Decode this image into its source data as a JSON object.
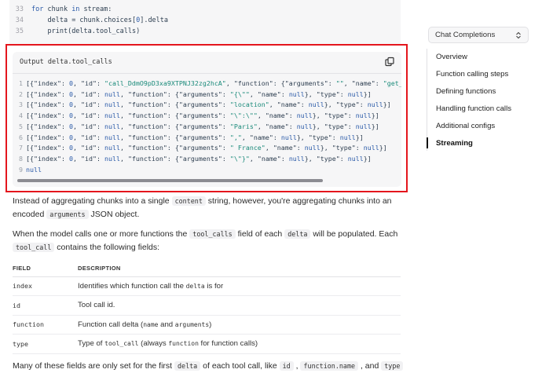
{
  "top_code": {
    "lines": [
      {
        "num": "33",
        "indent": 0,
        "parts": [
          [
            "kw",
            "for"
          ],
          [
            "k",
            " chunk "
          ],
          [
            "kw",
            "in"
          ],
          [
            "k",
            " stream:"
          ]
        ]
      },
      {
        "num": "34",
        "indent": 1,
        "parts": [
          [
            "k",
            "delta = chunk.choices["
          ],
          [
            "n",
            "0"
          ],
          [
            "k",
            "].delta"
          ]
        ]
      },
      {
        "num": "35",
        "indent": 1,
        "parts": [
          [
            "k",
            "print(delta.tool_calls)"
          ]
        ]
      }
    ]
  },
  "output": {
    "title": "Output delta.tool_calls",
    "lines": [
      {
        "num": "1",
        "text": "[{\"index\": 0, \"id\": \"call_DdmO9pD3xa9XTPNJ32zg2hcA\", \"function\": {\"arguments\": \"\", \"name\": \"get_weather\""
      },
      {
        "num": "2",
        "text": "[{\"index\": 0, \"id\": null, \"function\": {\"arguments\": \"{\\\"\", \"name\": null}, \"type\": null}]"
      },
      {
        "num": "3",
        "text": "[{\"index\": 0, \"id\": null, \"function\": {\"arguments\": \"location\", \"name\": null}, \"type\": null}]"
      },
      {
        "num": "4",
        "text": "[{\"index\": 0, \"id\": null, \"function\": {\"arguments\": \"\\\":\\\"\", \"name\": null}, \"type\": null}]"
      },
      {
        "num": "5",
        "text": "[{\"index\": 0, \"id\": null, \"function\": {\"arguments\": \"Paris\", \"name\": null}, \"type\": null}]"
      },
      {
        "num": "6",
        "text": "[{\"index\": 0, \"id\": null, \"function\": {\"arguments\": \",\", \"name\": null}, \"type\": null}]"
      },
      {
        "num": "7",
        "text": "[{\"index\": 0, \"id\": null, \"function\": {\"arguments\": \" France\", \"name\": null}, \"type\": null}]"
      },
      {
        "num": "8",
        "text": "[{\"index\": 0, \"id\": null, \"function\": {\"arguments\": \"\\\"}\", \"name\": null}, \"type\": null}]"
      },
      {
        "num": "9",
        "text": "null"
      }
    ]
  },
  "prose": {
    "p1": [
      {
        "t": "text",
        "v": "Instead of aggregating chunks into a single "
      },
      {
        "t": "code",
        "v": "content"
      },
      {
        "t": "text",
        "v": " string, however, you're aggregating chunks into an encoded "
      },
      {
        "t": "code",
        "v": "arguments"
      },
      {
        "t": "text",
        "v": " JSON object."
      }
    ],
    "p2": [
      {
        "t": "text",
        "v": "When the model calls one or more functions the "
      },
      {
        "t": "code",
        "v": "tool_calls"
      },
      {
        "t": "text",
        "v": " field of each "
      },
      {
        "t": "code",
        "v": "delta"
      },
      {
        "t": "text",
        "v": " will be populated. Each "
      },
      {
        "t": "code",
        "v": "tool_call"
      },
      {
        "t": "text",
        "v": " contains the following fields:"
      }
    ],
    "p3": [
      {
        "t": "text",
        "v": "Many of these fields are only set for the first "
      },
      {
        "t": "code",
        "v": "delta"
      },
      {
        "t": "text",
        "v": " of each tool call, like "
      },
      {
        "t": "code",
        "v": "id"
      },
      {
        "t": "text",
        "v": " , "
      },
      {
        "t": "code",
        "v": "function.name"
      },
      {
        "t": "text",
        "v": " , and "
      },
      {
        "t": "code",
        "v": "type"
      },
      {
        "t": "text",
        "v": " ."
      }
    ]
  },
  "table": {
    "headers": {
      "field": "FIELD",
      "description": "DESCRIPTION"
    },
    "rows": [
      {
        "field": "index",
        "desc": [
          {
            "t": "text",
            "v": "Identifies which function call the "
          },
          {
            "t": "code",
            "v": "delta"
          },
          {
            "t": "text",
            "v": " is for"
          }
        ]
      },
      {
        "field": "id",
        "desc": [
          {
            "t": "text",
            "v": "Tool call id."
          }
        ]
      },
      {
        "field": "function",
        "desc": [
          {
            "t": "text",
            "v": "Function call delta ("
          },
          {
            "t": "code",
            "v": "name"
          },
          {
            "t": "text",
            "v": " and "
          },
          {
            "t": "code",
            "v": "arguments"
          },
          {
            "t": "text",
            "v": ")"
          }
        ]
      },
      {
        "field": "type",
        "desc": [
          {
            "t": "text",
            "v": "Type of "
          },
          {
            "t": "code",
            "v": "tool_call"
          },
          {
            "t": "text",
            "v": " (always "
          },
          {
            "t": "code",
            "v": "function"
          },
          {
            "t": "text",
            "v": " for function calls)"
          }
        ]
      }
    ]
  },
  "sidebar": {
    "select_label": "Chat Completions",
    "select_icon": "chevron-updown-icon",
    "toc": [
      {
        "label": "Overview",
        "active": false
      },
      {
        "label": "Function calling steps",
        "active": false
      },
      {
        "label": "Defining functions",
        "active": false
      },
      {
        "label": "Handling function calls",
        "active": false
      },
      {
        "label": "Additional configs",
        "active": false
      },
      {
        "label": "Streaming",
        "active": true
      }
    ]
  },
  "colors": {
    "highlight_frame": "#e4161d",
    "code_background": "#f6f6f7"
  }
}
